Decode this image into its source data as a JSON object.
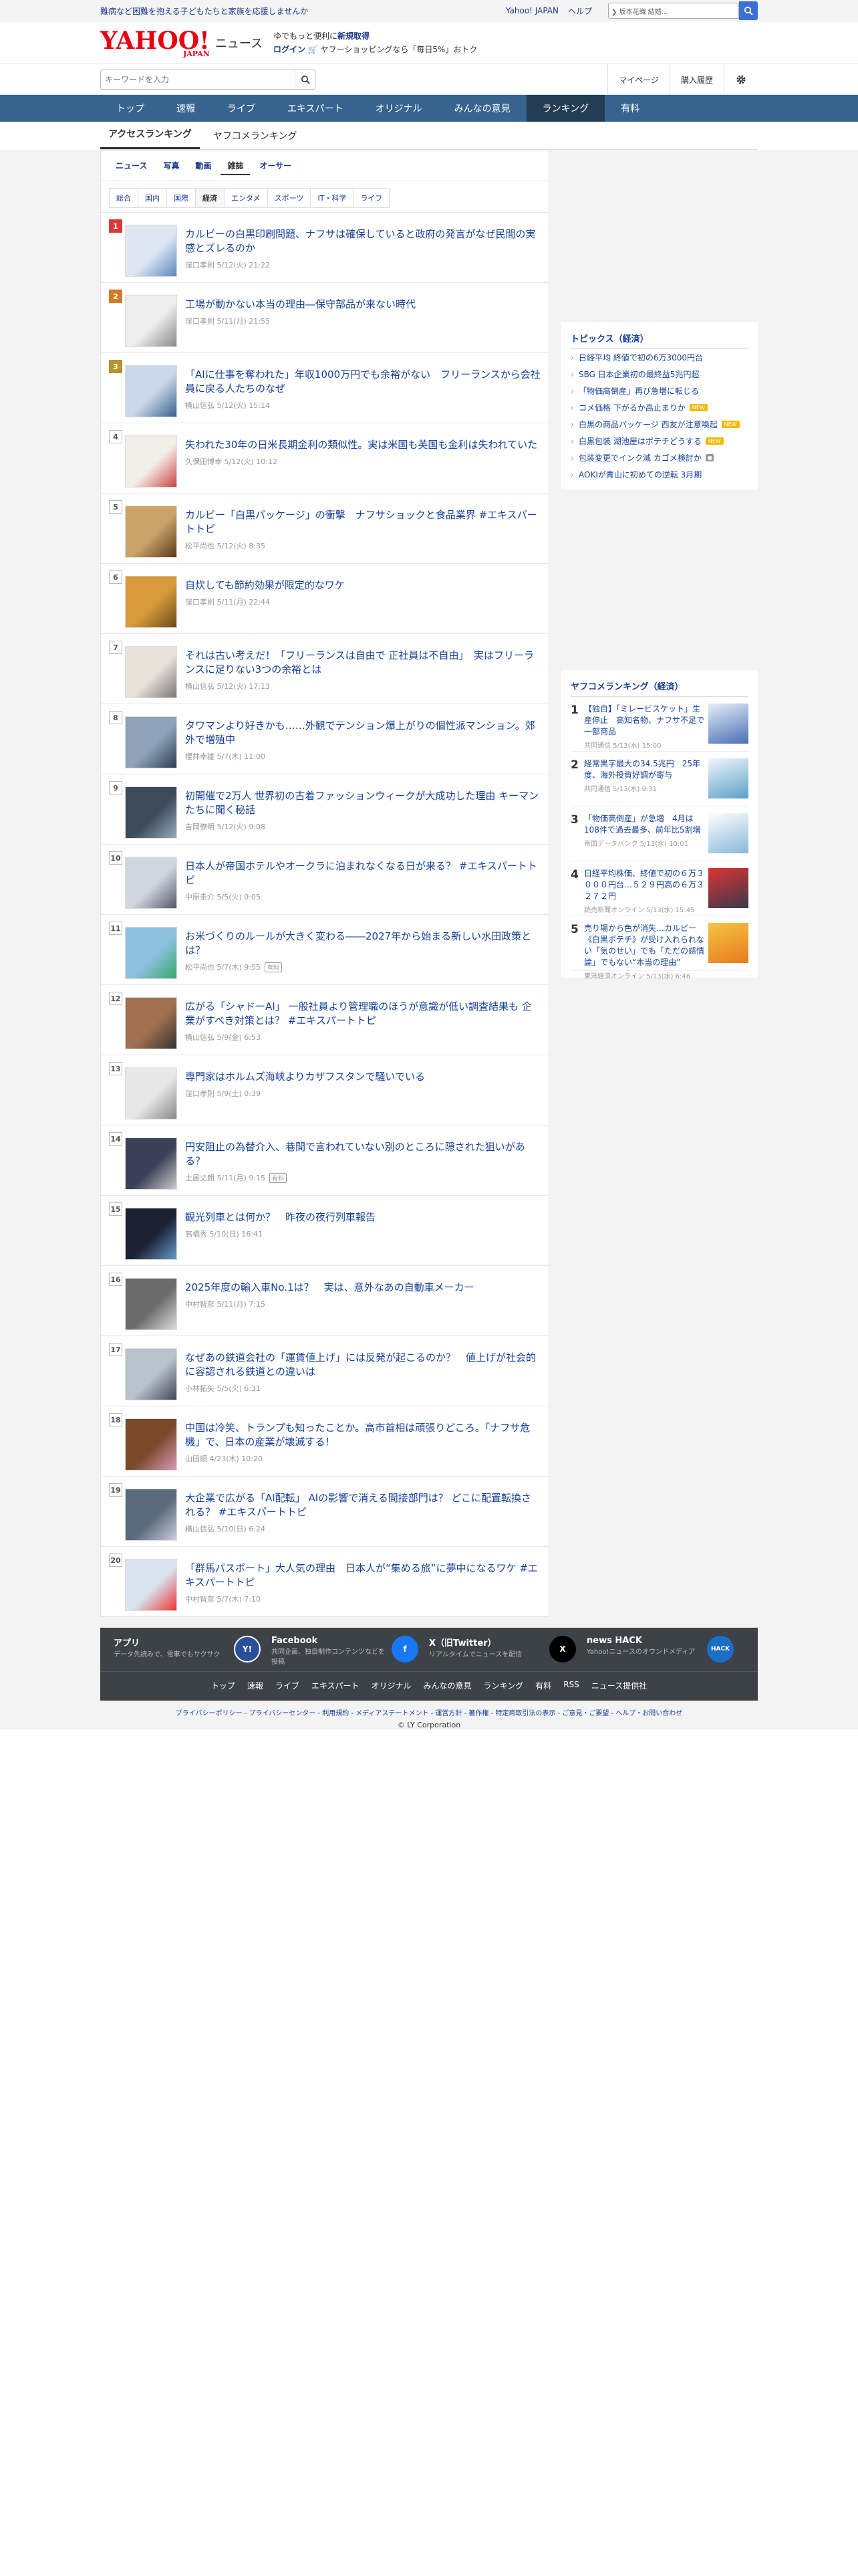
{
  "topbar": {
    "promo": "難病など困難を抱える子どもたちと家族を応援しませんか",
    "links": [
      "Yahoo! JAPAN",
      "ヘルプ"
    ],
    "search_placeholder": "ウェブ検索",
    "search_value": "❯ 坂本花織 結婚..."
  },
  "header": {
    "logo_main": "YAHOO!",
    "logo_sub_small": "JAPAN",
    "service": "ニュース",
    "promo_line1_prefix": "ゆでもっと便利に",
    "promo_line1_link": "新規取得",
    "promo_line2_link": "ログイン",
    "promo_line2_text": "ヤフーショッピングなら「毎日5%」おトク"
  },
  "search": {
    "placeholder": "キーワードを入力"
  },
  "header_buttons": [
    "マイページ",
    "購入履歴"
  ],
  "nav": [
    "トップ",
    "速報",
    "ライブ",
    "エキスパート",
    "オリジナル",
    "みんなの意見",
    "ランキング",
    "有料"
  ],
  "nav_active": 6,
  "subtabs": [
    "アクセスランキング",
    "ヤフコメランキング"
  ],
  "content_types": [
    "ニュース",
    "写真",
    "動画",
    "雑誌",
    "オーサー"
  ],
  "content_active": 3,
  "genres": [
    "総合",
    "国内",
    "国際",
    "経済",
    "エンタメ",
    "スポーツ",
    "IT・科学",
    "ライフ"
  ],
  "genre_active": 3,
  "ranking": [
    {
      "rank": "1",
      "title": "カルビーの白黒印刷問題、ナフサは確保していると政府の発言がなぜ民間の実感とズレるのか",
      "meta": "窪口孝則 5/12(火) 21:22",
      "badge": ""
    },
    {
      "rank": "2",
      "title": "工場が動かない本当の理由―保守部品が来ない時代",
      "meta": "窪口孝則 5/11(月) 21:55",
      "badge": ""
    },
    {
      "rank": "3",
      "title": "「AIに仕事を奪われた」年収1000万円でも余裕がない　フリーランスから会社員に戻る人たちのなぜ",
      "meta": "横山信弘 5/12(火) 15:14",
      "badge": ""
    },
    {
      "rank": "4",
      "title": "失われた30年の日米長期金利の類似性。実は米国も英国も金利は失われていた",
      "meta": "久保田博幸 5/12(火) 10:12",
      "badge": ""
    },
    {
      "rank": "5",
      "title": "カルビー「白黒パッケージ」の衝撃　ナフサショックと食品業界 #エキスパートトピ",
      "meta": "松平尚也 5/12(火) 8:35",
      "badge": ""
    },
    {
      "rank": "6",
      "title": "自炊しても節約効果が限定的なワケ",
      "meta": "窪口孝則 5/11(月) 22:44",
      "badge": ""
    },
    {
      "rank": "7",
      "title": "それは古い考えだ！「フリーランスは自由で 正社員は不自由」　実はフリーランスに足りない3つの余裕とは",
      "meta": "横山信弘 5/12(火) 17:13",
      "badge": ""
    },
    {
      "rank": "8",
      "title": "タワマンより好きかも……外観でテンション爆上がりの個性派マンション。郊外で増殖中",
      "meta": "櫻井幸雄 5/7(木) 11:00",
      "badge": ""
    },
    {
      "rank": "9",
      "title": "初開催で2万人 世界初の古着ファッションウィークが大成功した理由 キーマンたちに聞く秘話",
      "meta": "吉岡僚明 5/12(火) 9:08",
      "badge": ""
    },
    {
      "rank": "10",
      "title": "日本人が帝国ホテルやオークラに泊まれなくなる日が来る？ #エキスパートトピ",
      "meta": "中原圭介 5/5(火) 0:05",
      "badge": ""
    },
    {
      "rank": "11",
      "title": "お米づくりのルールが大きく変わる――2027年から始まる新しい水田政策とは？",
      "meta": "松平尚也 5/7(木) 9:55",
      "badge": "有料"
    },
    {
      "rank": "12",
      "title": "広がる「シャドーAI」 一般社員より管理職のほうが意識が低い調査結果も 企業がすべき対策とは？ #エキスパートトピ",
      "meta": "横山信弘 5/9(金) 6:53",
      "badge": ""
    },
    {
      "rank": "13",
      "title": "専門家はホルムズ海峡よりカザフスタンで騒いでいる",
      "meta": "窪口孝則 5/9(土) 0:39",
      "badge": ""
    },
    {
      "rank": "14",
      "title": "円安阻止の為替介入、巷間で言われていない別のところに隠された狙いがある？",
      "meta": "土居丈朗 5/11(月) 9:15",
      "badge": "有料"
    },
    {
      "rank": "15",
      "title": "観光列車とは何か？　昨夜の夜行列車報告",
      "meta": "高橋秀 5/10(日) 16:41",
      "badge": ""
    },
    {
      "rank": "16",
      "title": "2025年度の輸入車No.1は？　実は、意外なあの自動車メーカー",
      "meta": "中村智彦 5/11(月) 7:15",
      "badge": ""
    },
    {
      "rank": "17",
      "title": "なぜあの鉄道会社の「運賃値上げ」には反発が起こるのか？　値上げが社会的に容認される鉄道との違いは",
      "meta": "小林拓矢 5/5(火) 6:31",
      "badge": ""
    },
    {
      "rank": "18",
      "title": "中国は冷笑、トランプも知ったことか。高市首相は頑張りどころ。「ナフサ危機」で、日本の産業が壊滅する！",
      "meta": "山田順 4/23(木) 10:20",
      "badge": ""
    },
    {
      "rank": "19",
      "title": "大企業で広がる「AI配転」 AIの影響で消える間接部門は？ どこに配置転換される？ #エキスパートトピ",
      "meta": "横山信弘 5/10(日) 6:24",
      "badge": ""
    },
    {
      "rank": "20",
      "title": "「群馬パスポート」大人気の理由　日本人が“集める旅”に夢中になるワケ #エキスパートトピ",
      "meta": "中村智彦 5/7(木) 7:10",
      "badge": ""
    }
  ],
  "topics": {
    "heading": "トピックス（経済）",
    "items": [
      {
        "text": "日経平均 終値で初の6万3000円台",
        "badge": ""
      },
      {
        "text": "SBG 日本企業初の最終益5兆円超",
        "badge": ""
      },
      {
        "text": "「物価高倒産」再び急増に転じる",
        "badge": ""
      },
      {
        "text": "コメ価格 下がるか高止まりか",
        "badge": "NEW"
      },
      {
        "text": "白黒の商品パッケージ 西友が注意喚起",
        "badge": "NEW"
      },
      {
        "text": "白黒包装 湖池屋はポテチどうする",
        "badge": "NEW"
      },
      {
        "text": "包装変更でインク減 カゴメ検討か",
        "badge": "cam"
      },
      {
        "text": "AOKIが青山に初めての逆転 3月期",
        "badge": ""
      }
    ]
  },
  "yahoo_comment": {
    "heading": "ヤフコメランキング（経済）",
    "items": [
      {
        "rank": "1",
        "title": "【独自】「ミレービスケット」生産停止　高知名物、ナフサ不足で一部商品",
        "meta": "共同通信 5/13(水) 15:00"
      },
      {
        "rank": "2",
        "title": "経常黒字最大の34.5兆円　25年度、海外投資好調が寄与",
        "meta": "共同通信 5/13(水) 9:31"
      },
      {
        "rank": "3",
        "title": "「物価高倒産」が急増　4月は108件で過去最多、前年比5割増",
        "meta": "帝国データバンク 5/13(水) 10:01"
      },
      {
        "rank": "4",
        "title": "日経平均株価、終値で初の６万３０００円台…５２９円高の６万３２７２円",
        "meta": "読売新聞オンライン 5/13(水) 15:45"
      },
      {
        "rank": "5",
        "title": "売り場から色が消失…カルビー《白黒ポテチ》が受け入れられない「気のせい」でも「ただの感情論」でもない“本当の理由”",
        "meta": "東洋経済オンライン 5/13(水) 6:46"
      }
    ]
  },
  "footer": {
    "apps": [
      {
        "title": "アプリ",
        "desc": "データ先読みで、電車でもサクサク",
        "icon": "Y!"
      },
      {
        "title": "Facebook",
        "desc": "共同企画、独自制作コンテンツなどを投稿",
        "icon": "f"
      },
      {
        "title": "X（旧Twitter）",
        "desc": "リアルタイムでニュースを配信",
        "icon": "X"
      },
      {
        "title": "news HACK",
        "desc": "Yahoo!ニュースのオウンドメディア",
        "icon": "HACK"
      }
    ],
    "links": [
      "トップ",
      "速報",
      "ライブ",
      "エキスパート",
      "オリジナル",
      "みんなの意見",
      "ランキング",
      "有料",
      "RSS",
      "ニュース提供社"
    ],
    "legal": "プライバシーポリシー - プライバシーセンター - 利用規約 - メディアステートメント - 運営方針 - 著作権 - 特定商取引法の表示 - ご意見・ご要望 - ヘルプ・お問い合わせ",
    "copyright": "© LY Corporation"
  },
  "colors": {
    "accent": "#16409a",
    "nav": "#37648f",
    "logo": "#e60012"
  }
}
